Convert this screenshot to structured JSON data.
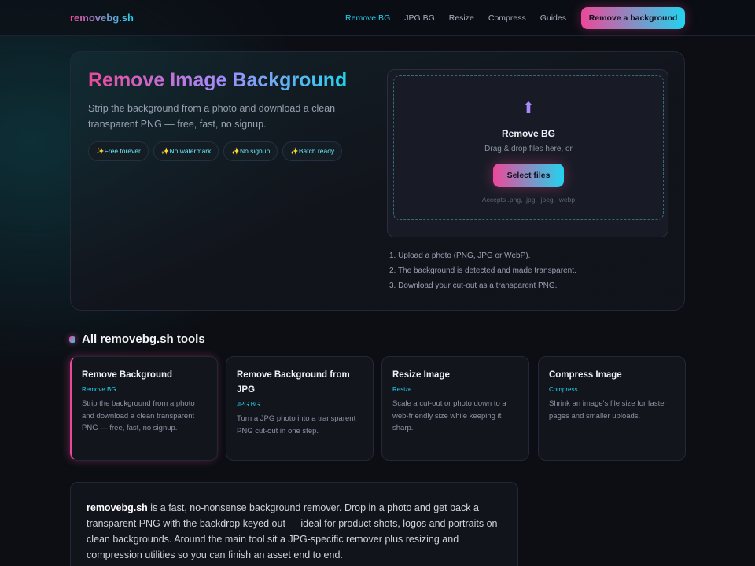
{
  "nav": {
    "logo": "removebg.sh",
    "links": [
      "Remove BG",
      "JPG BG",
      "Resize",
      "Compress",
      "Guides"
    ],
    "cta": "Remove a background"
  },
  "hero": {
    "title": "Remove Image Background",
    "subtitle": "Strip the background from a photo and download a clean transparent PNG — free, fast, no signup.",
    "badges": [
      "✨Free forever",
      "✨No watermark",
      "✨No signup",
      "✨Batch ready"
    ]
  },
  "upload": {
    "icon": "upload-arrow-icon",
    "icon_glyph": "⬆",
    "title": "Remove BG",
    "subtitle": "Drag & drop files here, or",
    "button": "Select files",
    "note": "Accepts .png, .jpg, .jpeg, .webp"
  },
  "steps": [
    "1. Upload a photo (PNG, JPG or WebP).",
    "2. The background is detected and made transparent.",
    "3. Download your cut-out as a transparent PNG."
  ],
  "tools_section": {
    "title": "All removebg.sh tools",
    "cards": [
      {
        "title": "Remove Background",
        "tag": "Remove BG",
        "desc": "Strip the background from a photo and download a clean transparent PNG — free, fast, no signup."
      },
      {
        "title": "Remove Background from JPG",
        "tag": "JPG BG",
        "desc": "Turn a JPG photo into a transparent PNG cut-out in one step."
      },
      {
        "title": "Resize Image",
        "tag": "Resize",
        "desc": "Scale a cut-out or photo down to a web-friendly size while keeping it sharp."
      },
      {
        "title": "Compress Image",
        "tag": "Compress",
        "desc": "Shrink an image's file size for faster pages and smaller uploads."
      }
    ]
  },
  "about": {
    "brand": "removebg.sh",
    "text": " is a fast, no-nonsense background remover. Drop in a photo and get back a transparent PNG with the backdrop keyed out — ideal for product shots, logos and portraits on clean backgrounds. Around the main tool sit a JPG-specific remover plus resizing and compression utilities so you can finish an asset end to end."
  },
  "colors": {
    "accent_pink": "#ec4899",
    "accent_cyan": "#22d3ee",
    "background": "#0c0e14"
  }
}
